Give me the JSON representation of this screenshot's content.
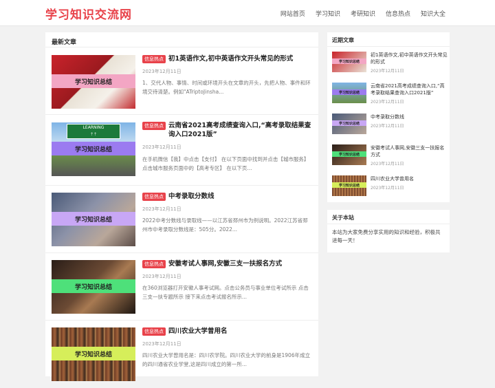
{
  "site": {
    "logo": "学习知识交流网"
  },
  "nav": [
    "网站首页",
    "学习知识",
    "考研知识",
    "信息热点",
    "知识大全"
  ],
  "main": {
    "title": "最新文章",
    "thumb_label": "学习知识总结",
    "articles": [
      {
        "badge": "信息热点",
        "title": "初1英语作文,初中英语作文开头常见的形式",
        "date": "2023年12月11日",
        "desc": "1、交代人物、事情、时间或环境开头在文章的开头，先把人物、事件和环境交待清楚。例如\"ATriptoJinsha..."
      },
      {
        "badge": "信息热点",
        "title": "云南省2021高考成绩查询入口,“高考录取结果查询入口2021版”",
        "date": "2023年12月11日",
        "desc": "在手机微信【我】中点击【支付】 在以下页面中找到并点击【城市服务】 点击城市服务页面中的【高考专区】 在以下页..."
      },
      {
        "badge": "信息热点",
        "title": "中考录取分数线",
        "date": "2023年12月11日",
        "desc": "2022中考分数线与录取线——以江苏省邳州市为例说明。2022江苏省邳州市中考录取分数线是：505分。2022..."
      },
      {
        "badge": "信息热点",
        "title": "安徽考试人事网,安徽三支一扶报名方式",
        "date": "2023年12月11日",
        "desc": "在360浏览器打开安徽人事考试网。点击公务员与事业单位考试所示 点击三支一扶专题所示 接下来点击考试报名所示..."
      },
      {
        "badge": "信息热点",
        "title": "四川农业大学曾用名",
        "date": "2023年12月11日",
        "desc": "四川农业大学曾用名是：四川农学院。四川农业大学的前身是1906年成立的四川通省农业学堂,这是四川成立的第一所..."
      }
    ]
  },
  "sidebar": {
    "recent_title": "近期文章",
    "recent": [
      {
        "title": "初1英语作文,初中英语作文开头常见的形式",
        "date": "2023年12月11日"
      },
      {
        "title": "云南省2021高考成绩查询入口,“高考录取结果查询入口2021版”",
        "date": "2023年12月11日"
      },
      {
        "title": "中考录取分数线",
        "date": "2023年12月11日"
      },
      {
        "title": "安徽考试人事网,安徽三支一扶报名方式",
        "date": "2023年12月11日"
      },
      {
        "title": "四川农业大学曾用名",
        "date": "2023年12月11日"
      }
    ],
    "about_title": "关于本站",
    "about_text": "本站为大家免费分享实用的知识和经验，积极共进每一天！"
  },
  "colors": {
    "brand": "#e8424a",
    "band_pink": "#f3a6c4",
    "band_purple": "#9b7bf0",
    "band_lilac": "#c8a7f5",
    "band_green": "#4ee07a",
    "band_yellow": "#d6ee5a"
  }
}
